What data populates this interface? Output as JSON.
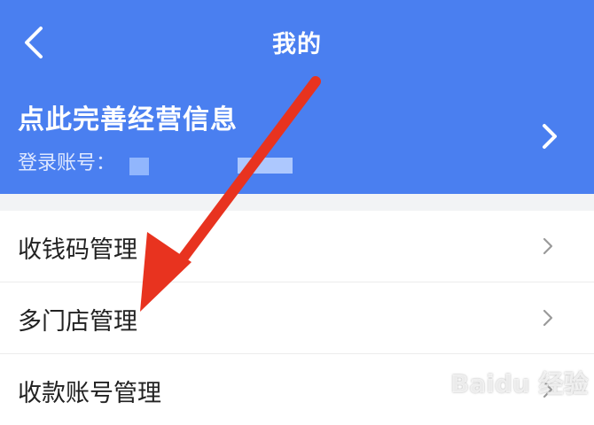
{
  "header": {
    "title": "我的",
    "back_icon": "chevron-left-icon",
    "background": "#4a7ff0"
  },
  "profile": {
    "name": "点此完善经营信息",
    "account_label": "登录账号：",
    "chevron_icon": "chevron-right-icon"
  },
  "menu": {
    "items": [
      {
        "label": "收钱码管理",
        "icon": "chevron-right-icon"
      },
      {
        "label": "多门店管理",
        "icon": "chevron-right-icon"
      },
      {
        "label": "收款账号管理",
        "icon": "chevron-right-icon"
      }
    ]
  },
  "annotation": {
    "color": "#e8331f"
  },
  "watermark": {
    "text": "Baidu 经验"
  }
}
